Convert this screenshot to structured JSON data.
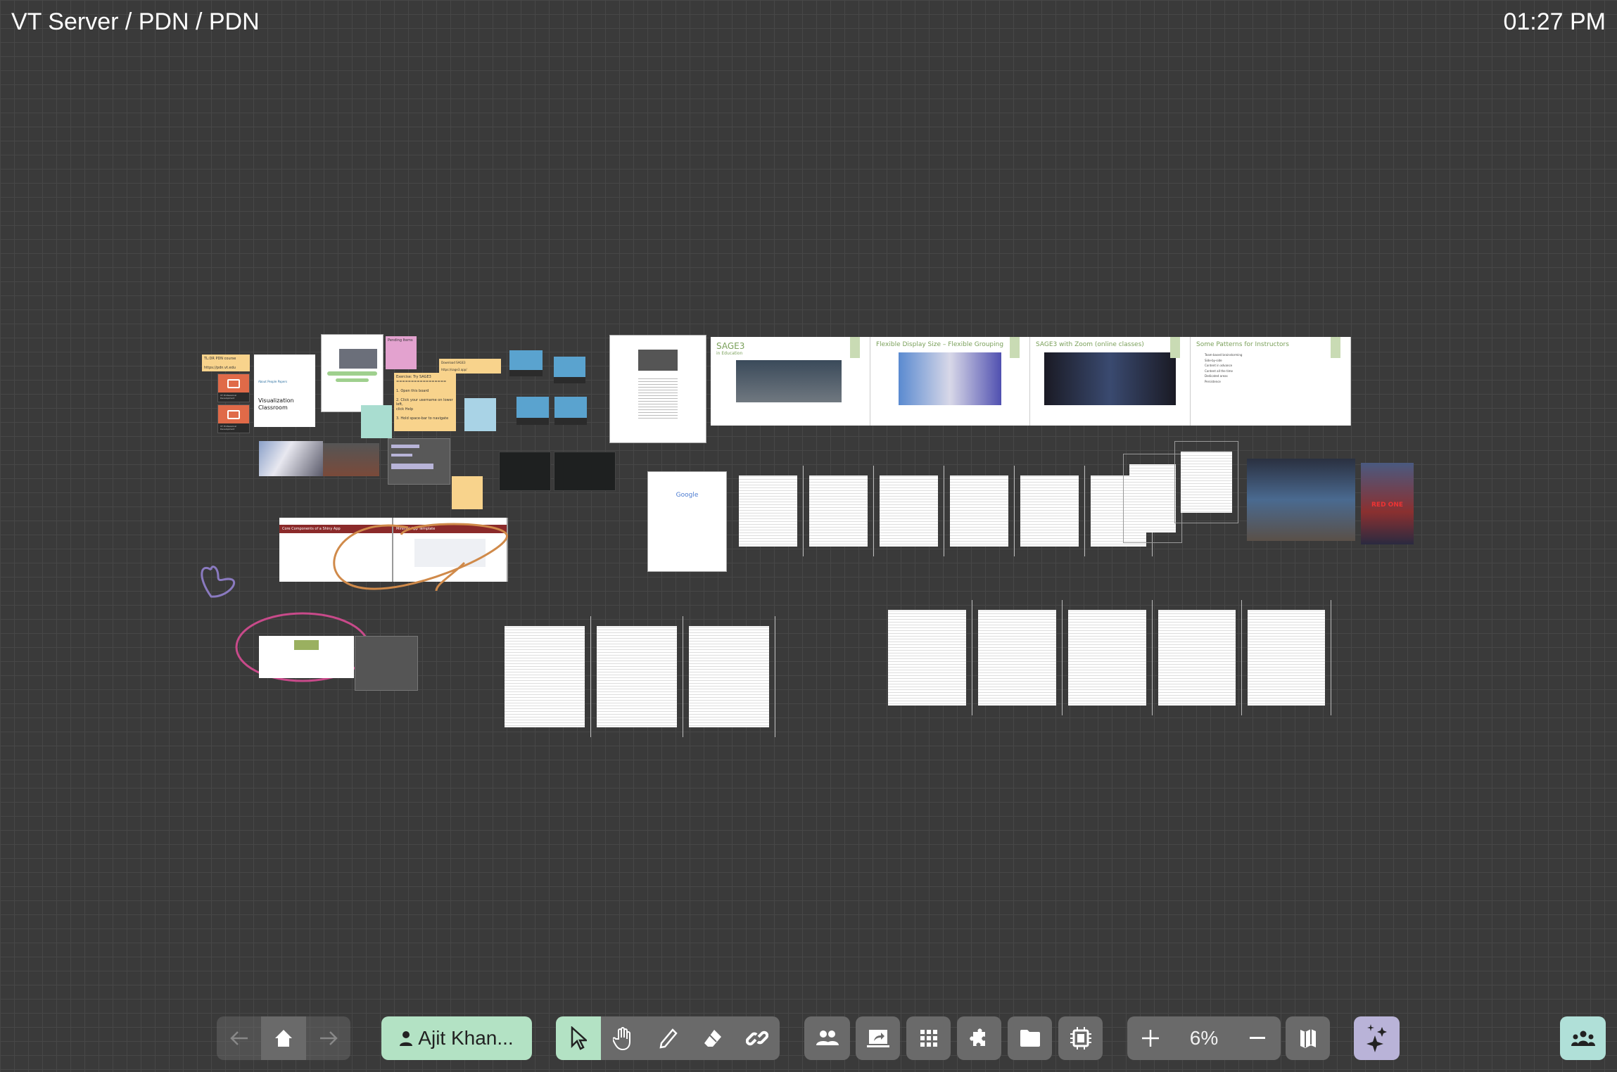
{
  "header": {
    "title": "VT Server / PDN / PDN",
    "time": "01:27 PM"
  },
  "board": {
    "stickies": {
      "pdn_course": "TL:DR PDN course\n\nhttps://pdn.vt.edu",
      "pending": "Pending Items",
      "download": "Download SAGE3\n\nhttps://sage3.app/",
      "exercise": "Exercise:  Try SAGE3\n=================\n\n1. Open this board\n\n2. Click your username on lower left,\nclick Help\n\n3. Hold space-bar to navigate"
    },
    "app_tiles": [
      "VT Professional Development",
      "VT Professional Development"
    ],
    "webpage_title": "Visualization Classroom",
    "webpage_links": "About  People  Papers",
    "slides": [
      {
        "title": "SAGE3",
        "subtitle": "in Education"
      },
      {
        "title": "Flexible Display Size – Flexible Grouping"
      },
      {
        "title": "SAGE3 with Zoom (online classes)"
      },
      {
        "title": "Some Patterns for Instructors",
        "bullets": [
          "Team-based brainstorming",
          "Side-by-side",
          "Content in advance",
          "Content all the time",
          "Dedicated areas",
          "Persistence"
        ]
      }
    ],
    "google_logo": "Google",
    "shiny_slides": [
      {
        "title": "Core Components of a Shiny App"
      },
      {
        "title": "Minimal App Template"
      }
    ],
    "poster_text": "RED ONE"
  },
  "toolbar": {
    "user_label": "Ajit Khan...",
    "zoom_level": "6%",
    "colors": {
      "user": "#b3e2c4",
      "active_tool": "#b3e2c4",
      "ai": "#b9b3d8",
      "collab": "#b0e0d8",
      "button": "#6a6a6a"
    }
  }
}
